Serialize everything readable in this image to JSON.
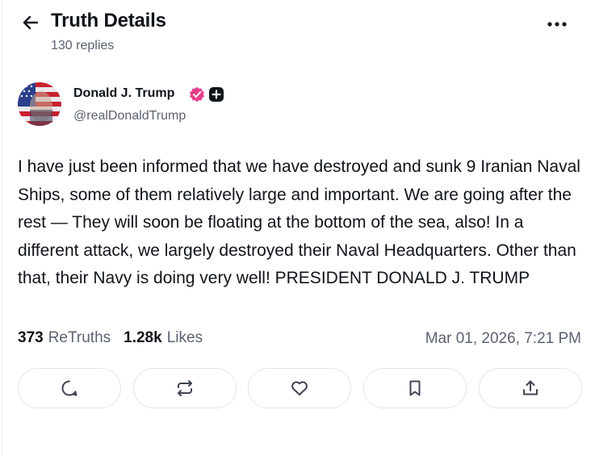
{
  "header": {
    "title": "Truth Details",
    "replies": "130 replies",
    "back_icon": "arrow-left-icon",
    "more_icon": "more-horizontal-icon"
  },
  "author": {
    "name": "Donald J. Trump",
    "handle": "@realDonaldTrump",
    "verified_badge_color": "#e83e8c",
    "plus_badge_color": "#0f1419"
  },
  "post": {
    "text": "I have just been informed that we have destroyed and sunk 9 Iranian Naval Ships, some of them relatively large and important. We are going after the rest — They will soon be floating at the bottom of the sea, also! In a different attack, we largely destroyed their Naval Headquarters. Other than that, their Navy is doing very well! PRESIDENT DONALD J. TRUMP"
  },
  "stats": {
    "retruths_count": "373",
    "retruths_label": "ReTruths",
    "likes_count": "1.28k",
    "likes_label": "Likes",
    "timestamp": "Mar 01, 2026, 7:21 PM"
  },
  "actions": [
    "reply-icon",
    "retruth-icon",
    "like-icon",
    "bookmark-icon",
    "share-icon"
  ],
  "colors": {
    "text": "#0f1419",
    "muted": "#5b6270",
    "border": "#e4e6eb"
  }
}
